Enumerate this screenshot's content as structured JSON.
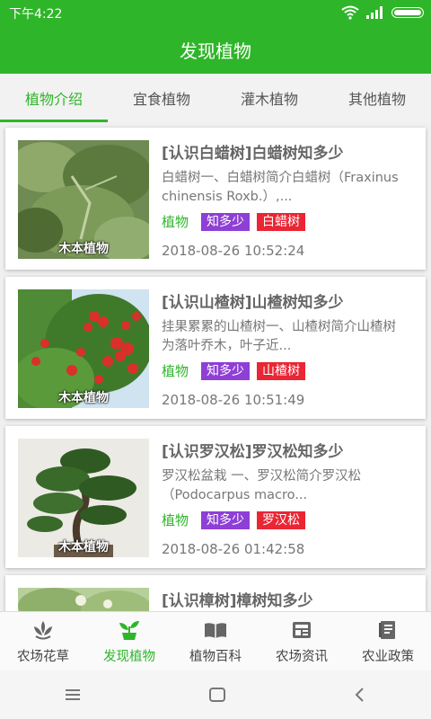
{
  "status": {
    "time": "下午4:22"
  },
  "header": {
    "title": "发现植物"
  },
  "tabs": [
    {
      "label": "植物介绍",
      "active": true
    },
    {
      "label": "宜食植物",
      "active": false
    },
    {
      "label": "灌木植物",
      "active": false
    },
    {
      "label": "其他植物",
      "active": false
    }
  ],
  "cards": [
    {
      "title": "[认识白蜡树]白蜡树知多少",
      "summary": "白蜡树一、白蜡树简介白蜡树（Fraxinus chinensis Roxb.）,...",
      "category": "植物",
      "tag1": "知多少",
      "tag2": "白蜡树",
      "date": "2018-08-26 10:52:24",
      "thumb_caption": "木本植物"
    },
    {
      "title": "[认识山楂树]山楂树知多少",
      "summary": "挂果累累的山楂树一、山楂树简介山楂树为落叶乔木，叶子近...",
      "category": "植物",
      "tag1": "知多少",
      "tag2": "山楂树",
      "date": "2018-08-26 10:51:49",
      "thumb_caption": "木本植物"
    },
    {
      "title": "[认识罗汉松]罗汉松知多少",
      "summary": "罗汉松盆栽 一、罗汉松简介罗汉松（Podocarpus macro...",
      "category": "植物",
      "tag1": "知多少",
      "tag2": "罗汉松",
      "date": "2018-08-26 01:42:58",
      "thumb_caption": "木本植物"
    },
    {
      "title": "[认识樟树]樟树知多少",
      "summary": "",
      "category": "",
      "tag1": "",
      "tag2": "",
      "date": "",
      "thumb_caption": ""
    }
  ],
  "bottom_nav": [
    {
      "label": "农场花草",
      "icon": "lotus-icon",
      "active": false
    },
    {
      "label": "发现植物",
      "icon": "sprout-icon",
      "active": true
    },
    {
      "label": "植物百科",
      "icon": "book-open-icon",
      "active": false
    },
    {
      "label": "农场资讯",
      "icon": "news-icon",
      "active": false
    },
    {
      "label": "农业政策",
      "icon": "policy-book-icon",
      "active": false
    }
  ],
  "colors": {
    "brand": "#2fb52a",
    "purple_tag": "#8e3fd6",
    "red_tag": "#ea2534"
  }
}
